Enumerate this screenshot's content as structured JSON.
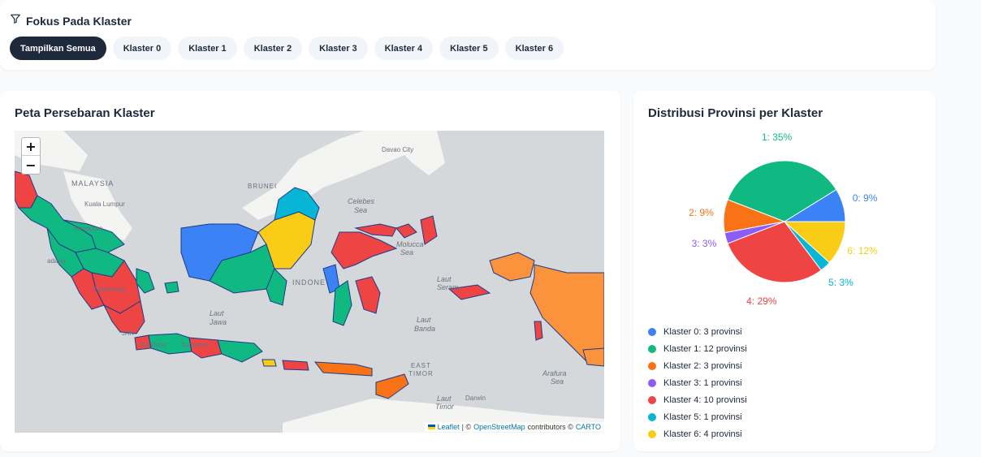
{
  "filter": {
    "title": "Fokus Pada Klaster",
    "buttons": [
      "Tampilkan Semua",
      "Klaster 0",
      "Klaster 1",
      "Klaster 2",
      "Klaster 3",
      "Klaster 4",
      "Klaster 5",
      "Klaster 6"
    ],
    "active": "Tampilkan Semua"
  },
  "map": {
    "title": "Peta Persebaran Klaster",
    "zoom_in": "+",
    "zoom_out": "−",
    "labels": {
      "malaysia": "MALAYSIA",
      "kuala_lumpur": "Kuala Lumpur",
      "brunei": "BRUNEI",
      "davao": "Davao City",
      "celebes": "Celebes",
      "celebes_sea": "Sea",
      "molucca": "Molucca",
      "molucca_sea": "Sea",
      "laut_jawa": "Laut",
      "jawa": "Jawa",
      "laut_banda": "Laut",
      "banda": "Banda",
      "east_timor": "EAST",
      "timor": "TIMOR",
      "laut_timor": "Laut",
      "timor2": "Timor",
      "arafura": "Arafura",
      "arafura_sea": "Sea",
      "darwin": "Darwin",
      "laut_seram": "Laut",
      "seram": "Seram",
      "indonesia": "INDONE",
      "palembang": "Palembang",
      "jakarta": "JAK",
      "singapore": "Singapore",
      "padang": "adang",
      "bandung": "Bandung",
      "surabaya": "Surabaya"
    },
    "attribution": {
      "leaflet": "Leaflet",
      "sep": "| ©",
      "osm": "OpenStreetMap",
      "contrib": "contributors ©",
      "carto": "CARTO"
    }
  },
  "distribution": {
    "title": "Distribusi Provinsi per Klaster"
  },
  "colors": {
    "k0": "#3b82f6",
    "k1": "#10b981",
    "k2": "#f97316",
    "k3": "#8b5cf6",
    "k4": "#ef4444",
    "k5": "#06b6d4",
    "k6": "#facc15",
    "papua_orange": "#fb923c"
  },
  "chart_data": {
    "type": "pie",
    "categories": [
      "0",
      "1",
      "2",
      "3",
      "4",
      "5",
      "6"
    ],
    "values": [
      3,
      12,
      3,
      1,
      10,
      1,
      4
    ],
    "slice_labels": [
      "0: 9%",
      "1: 35%",
      "2: 9%",
      "3: 3%",
      "4: 29%",
      "5: 3%",
      "6: 12%"
    ],
    "legend": [
      "Klaster 0: 3 provinsi",
      "Klaster 1: 12 provinsi",
      "Klaster 2: 3 provinsi",
      "Klaster 3: 1 provinsi",
      "Klaster 4: 10 provinsi",
      "Klaster 5: 1 provinsi",
      "Klaster 6: 4 provinsi"
    ],
    "colors": [
      "#3b82f6",
      "#10b981",
      "#f97316",
      "#8b5cf6",
      "#ef4444",
      "#06b6d4",
      "#facc15"
    ],
    "legend_position": "bottom"
  }
}
